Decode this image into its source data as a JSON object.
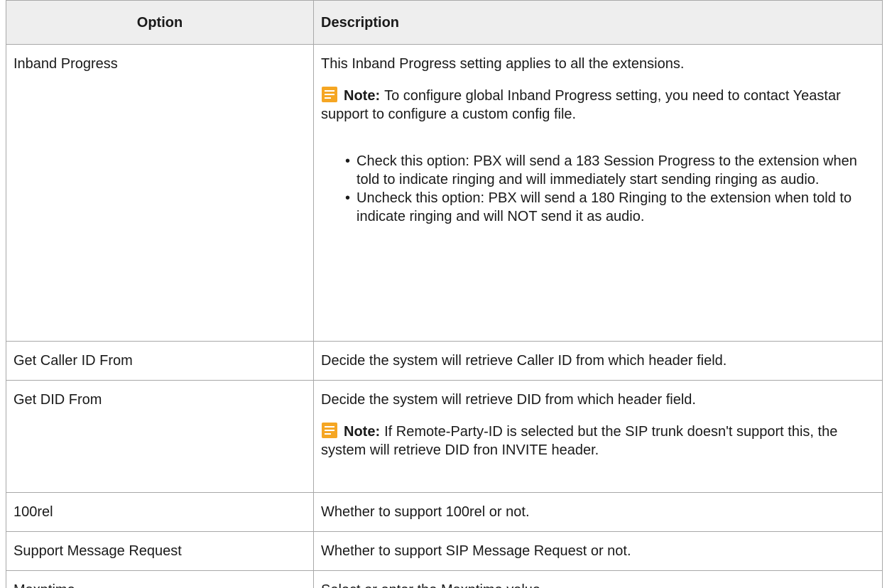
{
  "table": {
    "headers": {
      "option": "Option",
      "description": "Description"
    },
    "note_label": "Note:",
    "rows": [
      {
        "option": "Inband Progress",
        "description": "This Inband Progress setting applies to all the extensions.",
        "note": "To configure global Inband Progress setting, you need to contact Yeastar support to configure a custom config file.",
        "bullets": [
          "Check this option: PBX will send a 183 Session Progress to the extension when told to indicate ringing and will immediately start sending ringing as audio.",
          "Uncheck this option: PBX will send a 180 Ringing to the extension when told to indicate ringing and will NOT send it as audio."
        ]
      },
      {
        "option": "Get Caller ID From",
        "description": "Decide the system will retrieve Caller ID from which header field."
      },
      {
        "option": "Get DID From",
        "description": "Decide the system will retrieve DID from which header field.",
        "note": "If Remote-Party-ID is selected but the SIP trunk doesn't support this, the system will retrieve DID fron INVITE header."
      },
      {
        "option": "100rel",
        "description": "Whether to support 100rel or not."
      },
      {
        "option": "Support Message Request",
        "description": "Whether to support SIP Message Request or not."
      },
      {
        "option": "Maxptime",
        "description": "Select or enter the Maxptime value."
      }
    ]
  },
  "icons": {
    "note": "note-icon",
    "note_color": "#f5a623"
  }
}
